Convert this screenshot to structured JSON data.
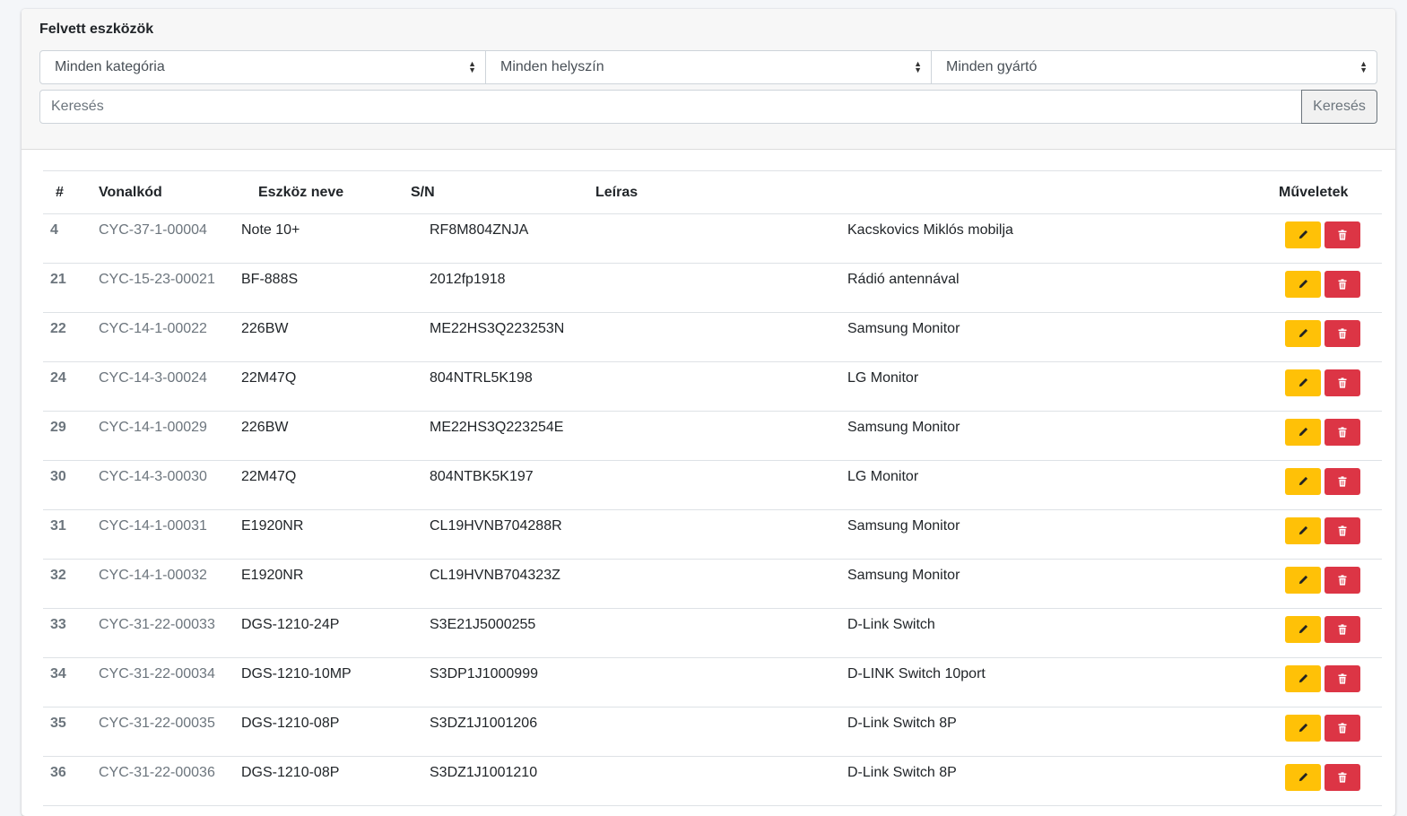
{
  "header": {
    "title": "Felvett eszközök",
    "filters": {
      "category": "Minden kategória",
      "location": "Minden helyszín",
      "manufacturer": "Minden gyártó"
    },
    "search": {
      "placeholder": "Keresés",
      "button": "Keresés"
    }
  },
  "table": {
    "columns": {
      "num": "#",
      "barcode": "Vonalkód",
      "name": "Eszköz neve",
      "sn": "S/N",
      "desc": "Leíras",
      "actions": "Műveletek"
    },
    "rows": [
      {
        "num": "4",
        "barcode": "CYC-37-1-00004",
        "name": "Note 10+",
        "sn": "RF8M804ZNJA",
        "desc": "Kacskovics Miklós mobilja"
      },
      {
        "num": "21",
        "barcode": "CYC-15-23-00021",
        "name": "BF-888S",
        "sn": "2012fp1918",
        "desc": "Rádió antennával"
      },
      {
        "num": "22",
        "barcode": "CYC-14-1-00022",
        "name": "226BW",
        "sn": "ME22HS3Q223253N",
        "desc": "Samsung Monitor"
      },
      {
        "num": "24",
        "barcode": "CYC-14-3-00024",
        "name": "22M47Q",
        "sn": "804NTRL5K198",
        "desc": "LG Monitor"
      },
      {
        "num": "29",
        "barcode": "CYC-14-1-00029",
        "name": "226BW",
        "sn": "ME22HS3Q223254E",
        "desc": "Samsung Monitor"
      },
      {
        "num": "30",
        "barcode": "CYC-14-3-00030",
        "name": "22M47Q",
        "sn": "804NTBK5K197",
        "desc": "LG Monitor"
      },
      {
        "num": "31",
        "barcode": "CYC-14-1-00031",
        "name": "E1920NR",
        "sn": "CL19HVNB704288R",
        "desc": "Samsung Monitor"
      },
      {
        "num": "32",
        "barcode": "CYC-14-1-00032",
        "name": "E1920NR",
        "sn": "CL19HVNB704323Z",
        "desc": "Samsung Monitor"
      },
      {
        "num": "33",
        "barcode": "CYC-31-22-00033",
        "name": "DGS-1210-24P",
        "sn": "S3E21J5000255",
        "desc": "D-Link Switch"
      },
      {
        "num": "34",
        "barcode": "CYC-31-22-00034",
        "name": "DGS-1210-10MP",
        "sn": "S3DP1J1000999",
        "desc": "D-LINK Switch 10port"
      },
      {
        "num": "35",
        "barcode": "CYC-31-22-00035",
        "name": "DGS-1210-08P",
        "sn": "S3DZ1J1001206",
        "desc": "D-Link Switch 8P"
      },
      {
        "num": "36",
        "barcode": "CYC-31-22-00036",
        "name": "DGS-1210-08P",
        "sn": "S3DZ1J1001210",
        "desc": "D-Link Switch 8P"
      }
    ],
    "icons": {
      "edit": "pencil-icon",
      "delete": "trash-icon"
    }
  },
  "colors": {
    "edit_button": "#ffc107",
    "delete_button": "#dc3545",
    "muted_text": "#6c757d"
  }
}
